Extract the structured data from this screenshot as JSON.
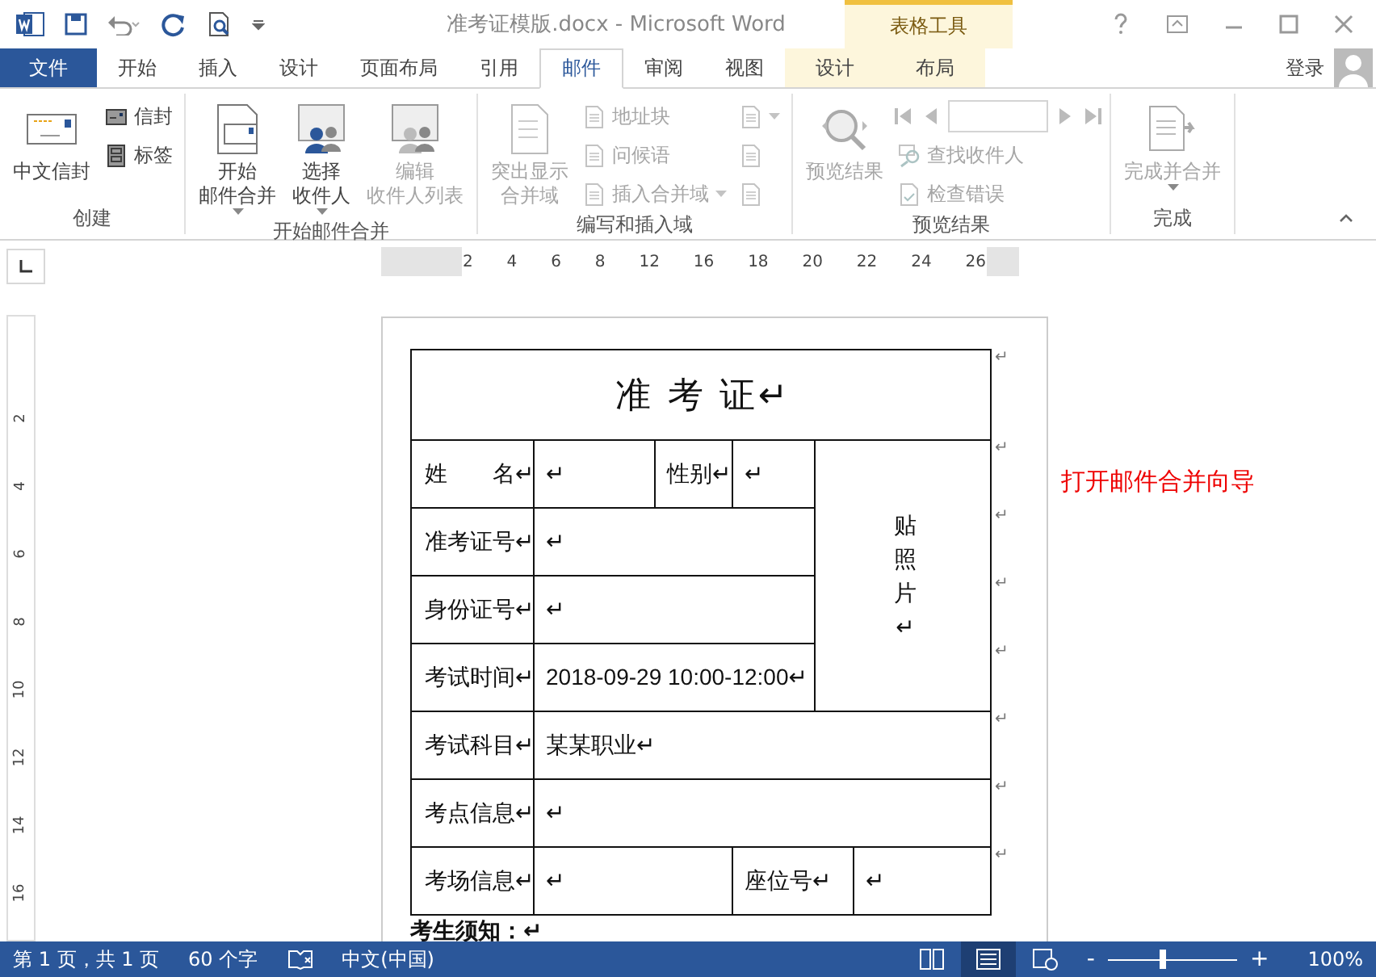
{
  "window": {
    "title": "准考证模版.docx - Microsoft Word",
    "context_title": "表格工具",
    "user": "登录"
  },
  "tabs": [
    {
      "label": "文件",
      "kind": "file",
      "selected": false
    },
    {
      "label": "开始",
      "kind": "normal",
      "selected": false
    },
    {
      "label": "插入",
      "kind": "normal",
      "selected": false
    },
    {
      "label": "设计",
      "kind": "normal",
      "selected": false
    },
    {
      "label": "页面布局",
      "kind": "normal",
      "selected": false
    },
    {
      "label": "引用",
      "kind": "normal",
      "selected": false
    },
    {
      "label": "邮件",
      "kind": "normal",
      "selected": true
    },
    {
      "label": "审阅",
      "kind": "normal",
      "selected": false
    },
    {
      "label": "视图",
      "kind": "normal",
      "selected": false
    },
    {
      "label": "设计",
      "kind": "contextual",
      "selected": false
    },
    {
      "label": "布局",
      "kind": "contextual",
      "selected": false
    }
  ],
  "ribbon": {
    "groups": [
      {
        "label": "创建",
        "items": [
          {
            "kind": "large",
            "lines": [
              "中文信封"
            ],
            "dropdown": false,
            "disabled": false
          },
          {
            "kind": "small",
            "label": "信封",
            "disabled": false
          },
          {
            "kind": "small",
            "label": "标签",
            "disabled": false
          }
        ]
      },
      {
        "label": "开始邮件合并",
        "items": [
          {
            "kind": "large",
            "lines": [
              "开始",
              "邮件合并"
            ],
            "dropdown": true,
            "disabled": false
          },
          {
            "kind": "large",
            "lines": [
              "选择",
              "收件人"
            ],
            "dropdown": true,
            "disabled": false
          },
          {
            "kind": "large",
            "lines": [
              "编辑",
              "收件人列表"
            ],
            "dropdown": false,
            "disabled": true
          }
        ]
      },
      {
        "label": "编写和插入域",
        "items": [
          {
            "kind": "large",
            "lines": [
              "突出显示",
              "合并域"
            ],
            "dropdown": false,
            "disabled": true
          },
          {
            "kind": "small",
            "label": "地址块",
            "disabled": true
          },
          {
            "kind": "small",
            "label": "问候语",
            "disabled": true
          },
          {
            "kind": "small",
            "label": "插入合并域",
            "dropdown": true,
            "disabled": true
          },
          {
            "kind": "icon",
            "dropdown": true,
            "disabled": true
          },
          {
            "kind": "icon",
            "dropdown": false,
            "disabled": true
          },
          {
            "kind": "icon",
            "dropdown": false,
            "disabled": true
          }
        ]
      },
      {
        "label": "预览结果",
        "items": [
          {
            "kind": "large",
            "lines": [
              "预览结果"
            ],
            "dropdown": false,
            "disabled": true
          },
          {
            "kind": "navigator",
            "disabled": true
          },
          {
            "kind": "small",
            "label": "查找收件人",
            "disabled": true
          },
          {
            "kind": "small",
            "label": "检查错误",
            "disabled": true
          }
        ]
      },
      {
        "label": "完成",
        "items": [
          {
            "kind": "large",
            "lines": [
              "完成并合并"
            ],
            "dropdown": true,
            "disabled": true
          }
        ]
      }
    ]
  },
  "ruler": {
    "labels": [
      "2",
      "4",
      "6",
      "8",
      "12",
      "16",
      "18",
      "20",
      "22",
      "24",
      "26"
    ],
    "vertical_labels": [
      "2",
      "4",
      "6",
      "8",
      "10",
      "12",
      "14",
      "16"
    ]
  },
  "document": {
    "title": "准 考 证↵",
    "end_mark": "↵",
    "rows": [
      {
        "cells": [
          {
            "kind": "label",
            "text": "姓　　名↵"
          },
          {
            "kind": "field",
            "text": "↵"
          },
          {
            "kind": "field",
            "text": "性别↵"
          },
          {
            "kind": "field",
            "text": "↵"
          },
          {
            "kind": "photo",
            "text": "贴照片↵",
            "colspan": 2,
            "rowspan": 4
          }
        ]
      },
      {
        "cells": [
          {
            "kind": "label",
            "text": "准考证号↵"
          },
          {
            "kind": "field_medium",
            "text": "↵",
            "colspan": 3
          }
        ]
      },
      {
        "cells": [
          {
            "kind": "label",
            "text": "身份证号↵"
          },
          {
            "kind": "field_medium",
            "text": "↵",
            "colspan": 3
          }
        ]
      },
      {
        "cells": [
          {
            "kind": "label",
            "text": "考试时间↵"
          },
          {
            "kind": "field_medium",
            "text": "2018-09-29 10:00-12:00↵",
            "colspan": 3
          }
        ]
      },
      {
        "cells": [
          {
            "kind": "label",
            "text": "考试科目↵"
          },
          {
            "kind": "field_wide",
            "text": "某某职业↵",
            "colspan": 5
          }
        ]
      },
      {
        "cells": [
          {
            "kind": "label",
            "text": "考点信息↵"
          },
          {
            "kind": "field_wide",
            "text": "↵",
            "colspan": 5
          }
        ]
      },
      {
        "cells": [
          {
            "kind": "label",
            "text": "考场信息↵"
          },
          {
            "kind": "field_pair",
            "text": "↵",
            "colspan": 2
          },
          {
            "kind": "field_pair",
            "text": "座位号↵",
            "colspan": 2
          },
          {
            "kind": "field",
            "text": "↵"
          }
        ]
      }
    ],
    "notice": "考生须知：↵",
    "side_note": "打开邮件合并向导"
  },
  "status_bar": {
    "page": "第 1 页，共 1 页",
    "words": "60 个字",
    "language": "中文(中国)",
    "zoom_minus": "-",
    "zoom_plus": "+",
    "zoom": "100%",
    "level": 0.43
  }
}
